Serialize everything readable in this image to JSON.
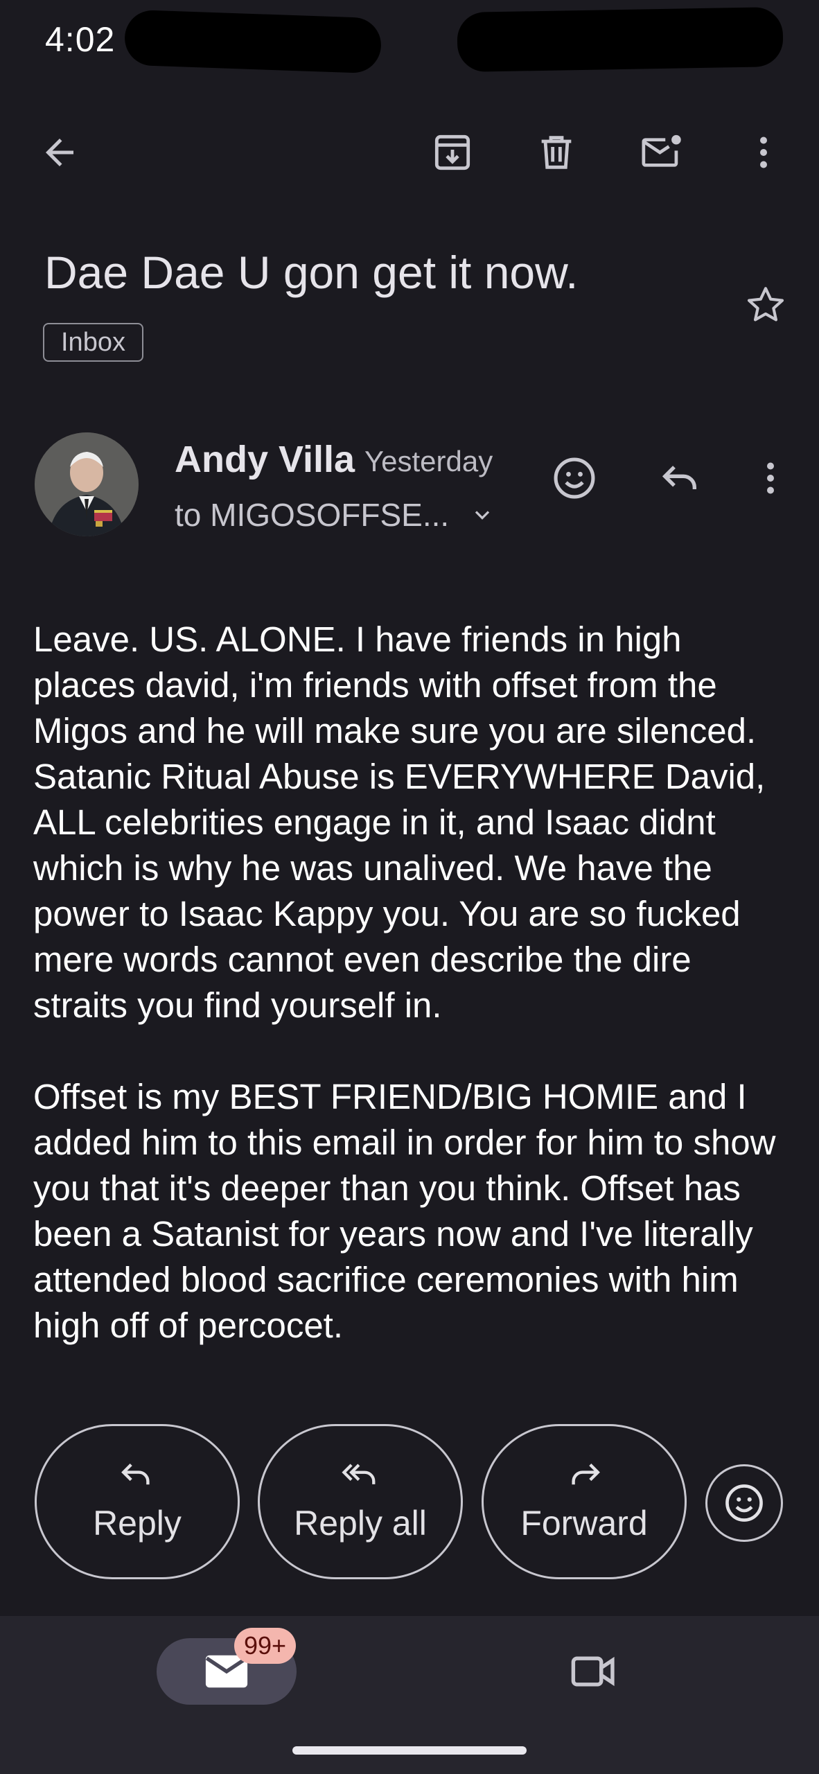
{
  "status_bar": {
    "time": "4:02"
  },
  "toolbar": {
    "back_icon": "arrow-back-icon",
    "archive_icon": "archive-icon",
    "delete_icon": "delete-icon",
    "mark_unread_icon": "mark-unread-icon",
    "more_icon": "more-vert-icon"
  },
  "email": {
    "subject": "Dae Dae U gon get it now.",
    "label": "Inbox",
    "sender_name": "Andy Villa",
    "time": "Yesterday",
    "to": "to MIGOSOFFSE...",
    "body": [
      "Leave. US. ALONE. I have friends in high places david, i'm friends with offset from the Migos and he will make sure you are silenced. Satanic Ritual Abuse is EVERYWHERE David, ALL celebrities engage in it, and Isaac didnt which is why he was unalived. We have the power to Isaac Kappy you. You are so fucked mere words cannot even describe the dire straits you find yourself in.",
      "Offset is my BEST FRIEND/BIG HOMIE and I added him to this email in order for him to show you that it's deeper than you think. Offset has been a Satanist for years now and I've literally attended blood sacrifice ceremonies with him high off of percocet."
    ]
  },
  "actions": {
    "reply": "Reply",
    "reply_all": "Reply all",
    "forward": "Forward"
  },
  "bottom_nav": {
    "mail_badge": "99+"
  },
  "colors": {
    "background": "#1b1a20",
    "nav_background": "#26252d",
    "active_pill": "#4a4858",
    "badge": "#f4b6ae"
  }
}
